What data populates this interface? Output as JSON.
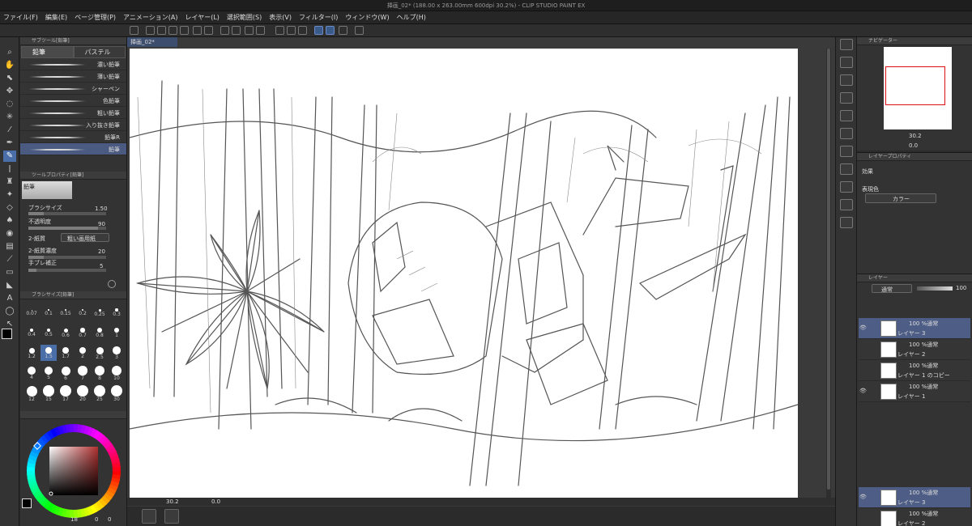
{
  "window": {
    "title": "挿画_02* (188.00 x 263.00mm 600dpi 30.2%) - CLIP STUDIO PAINT EX"
  },
  "menu": [
    "ファイル(F)",
    "編集(E)",
    "ページ管理(P)",
    "アニメーション(A)",
    "レイヤー(L)",
    "選択範囲(S)",
    "表示(V)",
    "フィルター(I)",
    "ウィンドウ(W)",
    "ヘルプ(H)"
  ],
  "subtool": {
    "header": "サブツール[鉛筆]",
    "tabs": [
      "鉛筆",
      "パステル"
    ],
    "brushes": [
      "濃い鉛筆",
      "薄い鉛筆",
      "シャーペン",
      "色鉛筆",
      "粗い鉛筆",
      "入り抜き鉛筆",
      "鉛筆R",
      "鉛筆"
    ],
    "selected_brush": "鉛筆"
  },
  "tool_property": {
    "header": "ツールプロパティ[鉛筆]",
    "tool_name": "鉛筆",
    "brush_size_label": "ブラシサイズ",
    "brush_size_value": "1.50",
    "opacity_label": "不透明度",
    "opacity_value": "90",
    "paper_label": "2-紙質",
    "paper_value": "粗い画用紙",
    "paper_density_label": "2-紙質濃度",
    "paper_density_value": "20",
    "stabilizer_label": "手ブレ補正",
    "stabilizer_value": "5"
  },
  "brush_size_panel": {
    "header": "ブラシサイズ[鉛筆]",
    "sizes": [
      "0.07",
      "0.1",
      "0.15",
      "0.2",
      "0.25",
      "0.3",
      "0.4",
      "0.5",
      "0.6",
      "0.7",
      "0.8",
      "1",
      "1.2",
      "1.5",
      "1.7",
      "2",
      "2.5",
      "3",
      "4",
      "5",
      "6",
      "7",
      "8",
      "10",
      "12",
      "15",
      "17",
      "20",
      "25",
      "30"
    ],
    "selected_size": "1.5"
  },
  "color_panel": {
    "hue_color": "#b03030",
    "values": [
      "18",
      "0",
      "0"
    ]
  },
  "document": {
    "tab_label": "挿画_02*",
    "zoom": "30.2",
    "angle": "0.0"
  },
  "navigator": {
    "header": "ナビゲーター",
    "zoom": "30.2",
    "angle": "0.0"
  },
  "layer_property": {
    "header": "レイヤープロパティ",
    "effect_label": "効果",
    "expression_color_label": "表現色",
    "expression_color_value": "カラー"
  },
  "layer_panel": {
    "header": "レイヤー",
    "blend_mode": "通常",
    "opacity": "100",
    "layers": [
      {
        "mode": "100 %通常",
        "name": "レイヤー 3",
        "selected": true
      },
      {
        "mode": "100 %通常",
        "name": "レイヤー 2",
        "selected": false
      },
      {
        "mode": "100 %通常",
        "name": "レイヤー 1 のコピー",
        "selected": false
      },
      {
        "mode": "100 %通常",
        "name": "レイヤー 1",
        "selected": false
      }
    ],
    "bottom_layers": [
      {
        "mode": "100 %通常",
        "name": "レイヤー 3",
        "selected": true
      },
      {
        "mode": "100 %通常",
        "name": "レイヤー 2",
        "selected": false
      }
    ]
  },
  "colors": {
    "accent": "#4a6ea8",
    "selected_layer": "#4d5d85",
    "panel_bg": "#333333"
  }
}
